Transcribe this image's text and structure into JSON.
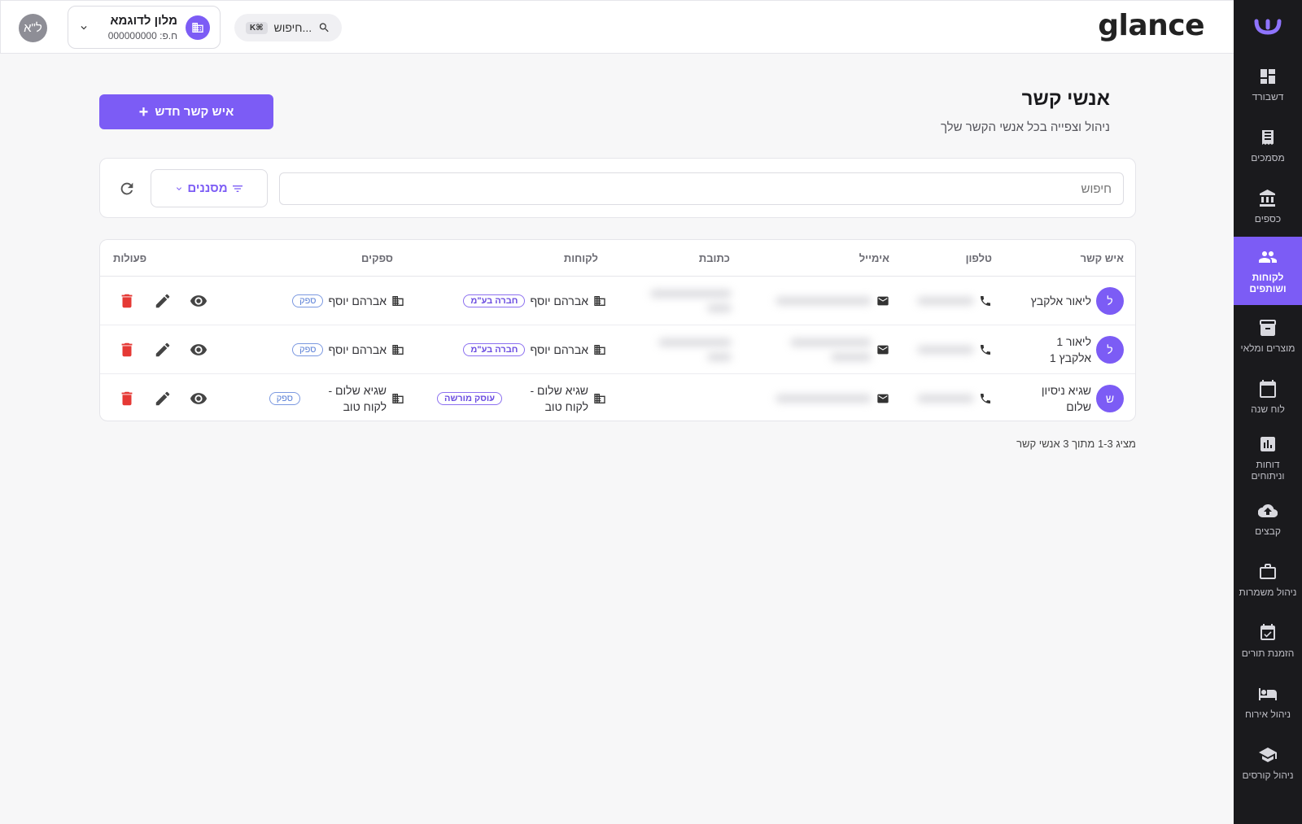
{
  "brand": "glance",
  "topbar": {
    "user_initials": "ל\"א",
    "org_name": "מלון לדוגמא",
    "org_sub": "ח.פ: 000000000",
    "search_label": "חיפוש...",
    "search_kbd": "K⌘"
  },
  "sidebar": {
    "items": [
      {
        "label": "דשבורד",
        "icon": "dashboard-icon"
      },
      {
        "label": "מסמכים",
        "icon": "document-icon"
      },
      {
        "label": "כספים",
        "icon": "bank-icon"
      },
      {
        "label": "לקוחות ושותפים",
        "icon": "people-icon",
        "active": true
      },
      {
        "label": "מוצרים ומלאי",
        "icon": "archive-icon"
      },
      {
        "label": "לוח שנה",
        "icon": "calendar-icon"
      },
      {
        "label": "דוחות וניתוחים",
        "icon": "chart-icon"
      },
      {
        "label": "קבצים",
        "icon": "cloud-upload-icon"
      },
      {
        "label": "ניהול משמרות",
        "icon": "briefcase-icon"
      },
      {
        "label": "הזמנת תורים",
        "icon": "calendar-check-icon"
      },
      {
        "label": "ניהול אירוח",
        "icon": "bed-icon"
      },
      {
        "label": "ניהול קורסים",
        "icon": "school-icon"
      }
    ]
  },
  "page": {
    "title": "אנשי קשר",
    "subtitle": "ניהול וצפייה בכל אנשי הקשר שלך",
    "new_button": "איש קשר חדש",
    "search_placeholder": "חיפוש",
    "filters_label": "מסננים",
    "footer": "מציג 1-3 מתוך 3 אנשי קשר"
  },
  "table": {
    "headers": {
      "contact": "איש קשר",
      "phone": "טלפון",
      "email": "אימייל",
      "address": "כתובת",
      "clients": "לקוחות",
      "suppliers": "ספקים",
      "actions": "פעולות"
    },
    "rows": [
      {
        "initial": "ל",
        "name": "ליאור אלקבץ",
        "client": "אברהם יוסף",
        "client_tag": "חברה בע\"מ",
        "supplier": "אברהם יוסף",
        "supplier_tag": "ספק"
      },
      {
        "initial": "ל",
        "name": "ליאור 1 אלקבץ 1",
        "client": "אברהם יוסף",
        "client_tag": "חברה בע\"מ",
        "supplier": "אברהם יוסף",
        "supplier_tag": "ספק"
      },
      {
        "initial": "ש",
        "name": "שגיא ניסיון שלום",
        "client": "שגיא שלום - לקוח טוב",
        "client_tag": "עוסק מורשה",
        "supplier": "שגיא שלום - לקוח טוב",
        "supplier_tag": "ספק"
      }
    ]
  },
  "colors": {
    "accent": "#7c5cf5",
    "sidebar_bg": "#1a1a1d",
    "delete": "#e53935"
  }
}
